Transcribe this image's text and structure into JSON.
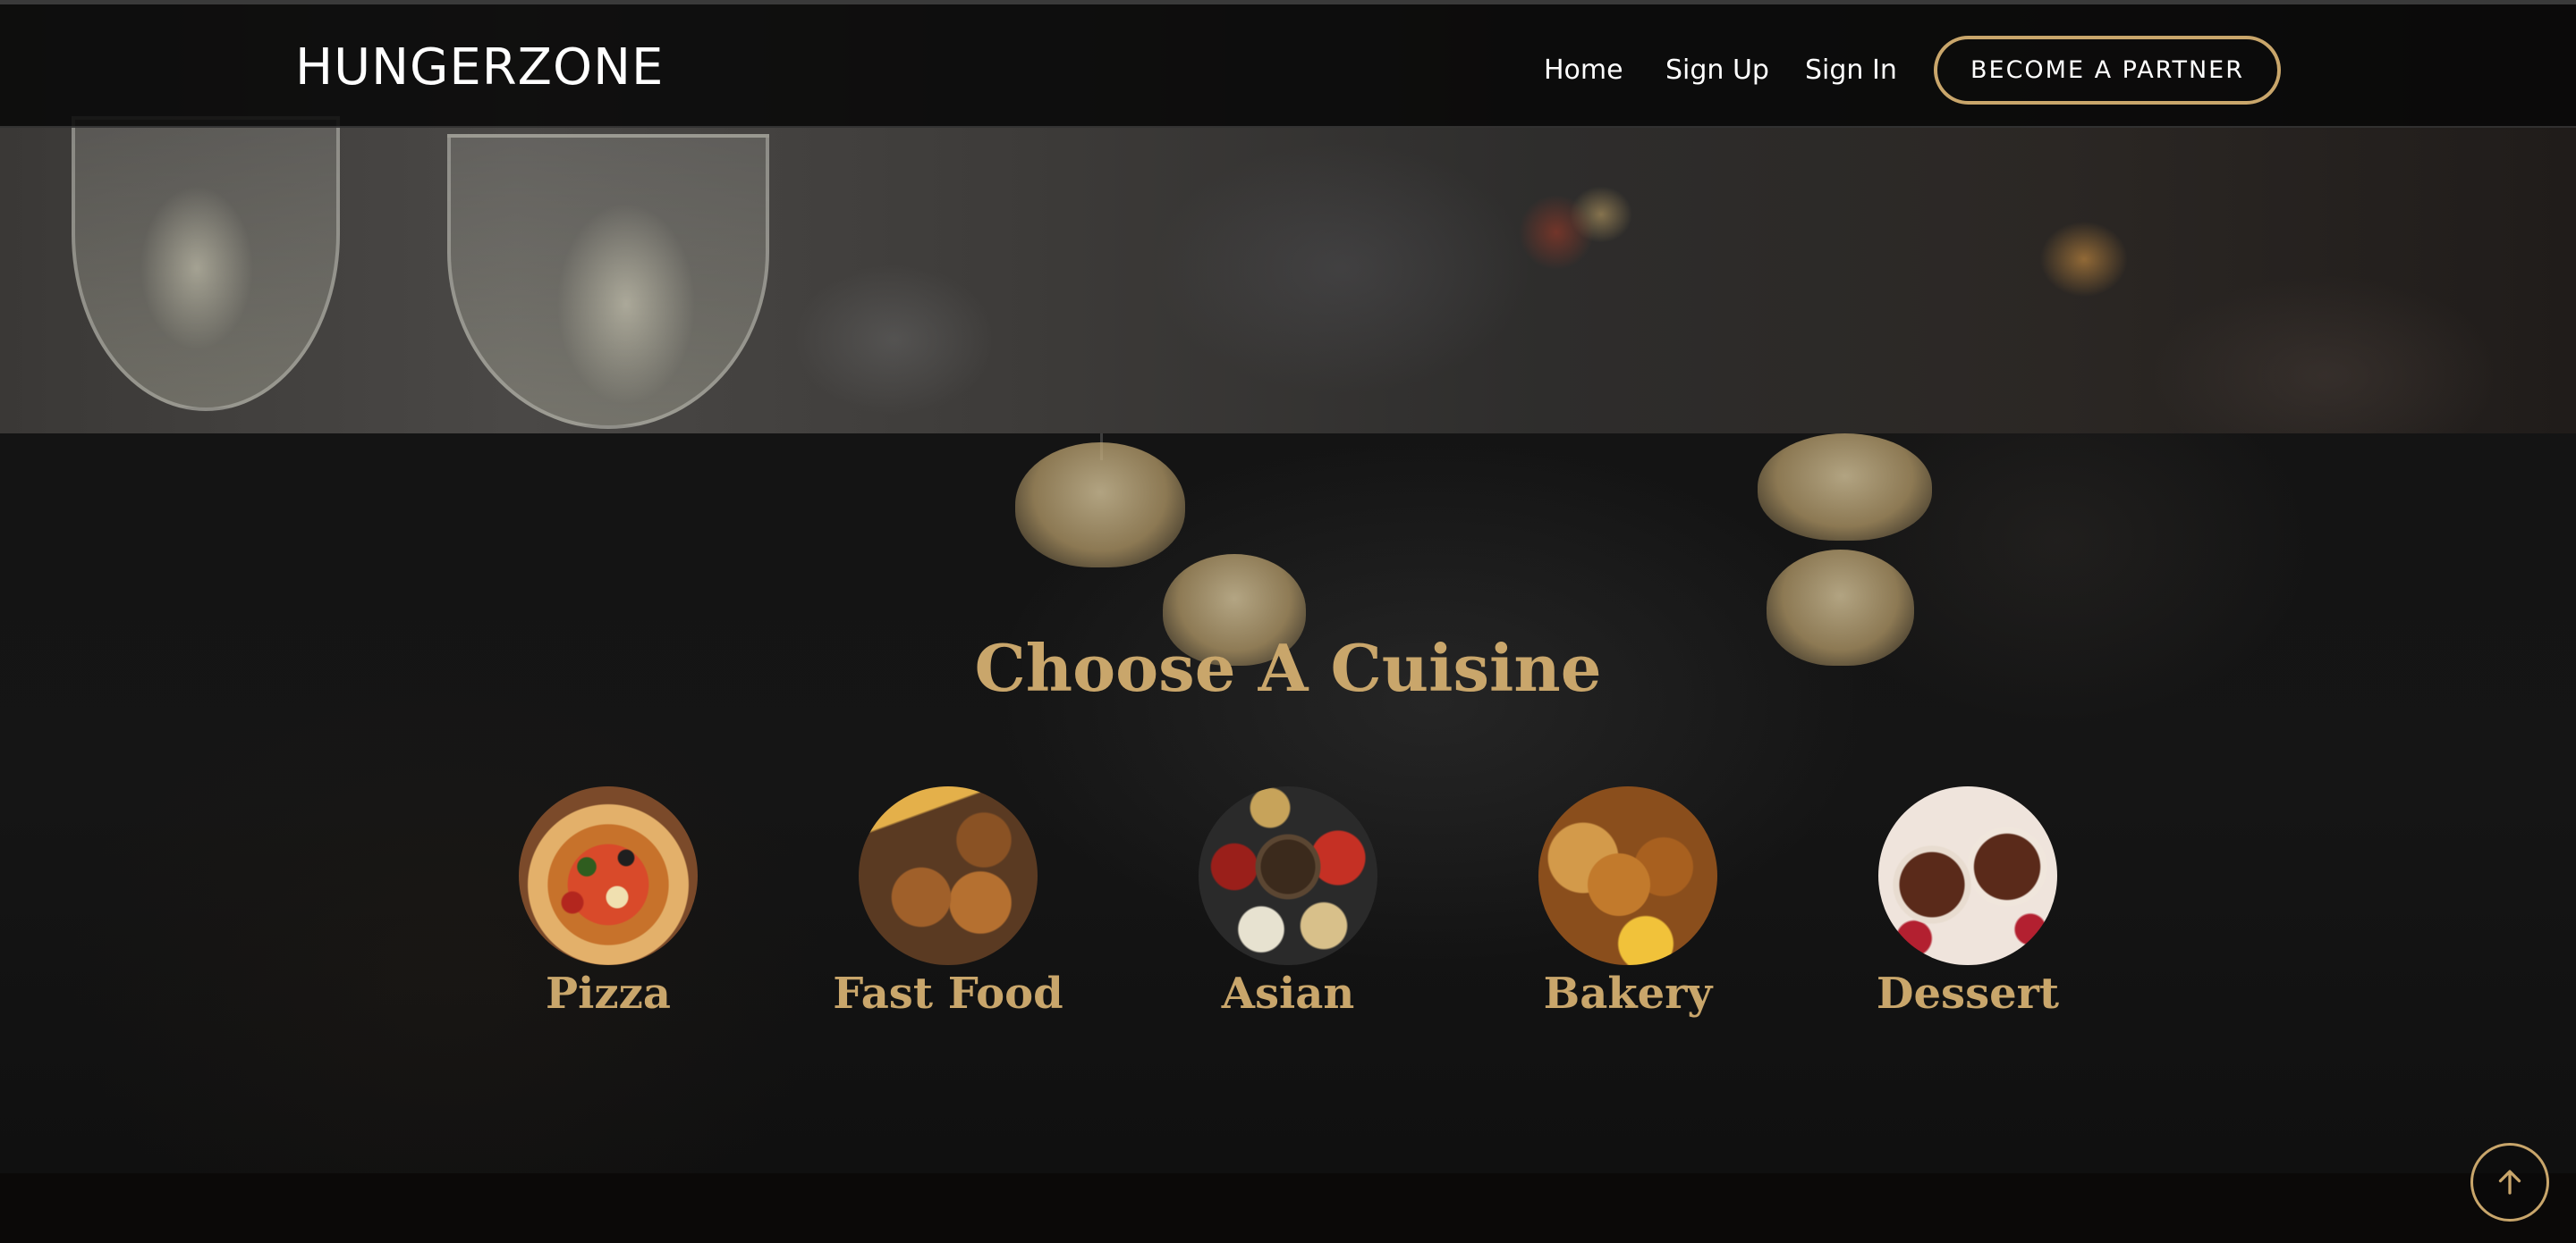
{
  "nav": {
    "brand": "HUNGERZONE",
    "links": [
      {
        "label": "Home"
      },
      {
        "label": "Sign Up"
      },
      {
        "label": "Sign In"
      }
    ],
    "partner_button": "BECOME A PARTNER"
  },
  "cuisine": {
    "title": "Choose A Cuisine",
    "items": [
      {
        "label": "Pizza"
      },
      {
        "label": "Fast Food"
      },
      {
        "label": "Asian"
      },
      {
        "label": "Bakery"
      },
      {
        "label": "Dessert"
      }
    ]
  },
  "colors": {
    "accent": "#c9a66b",
    "navbar_bg": "#080808",
    "section_bg": "#141414"
  },
  "icons": {
    "back_to_top": "arrow-up-icon"
  }
}
